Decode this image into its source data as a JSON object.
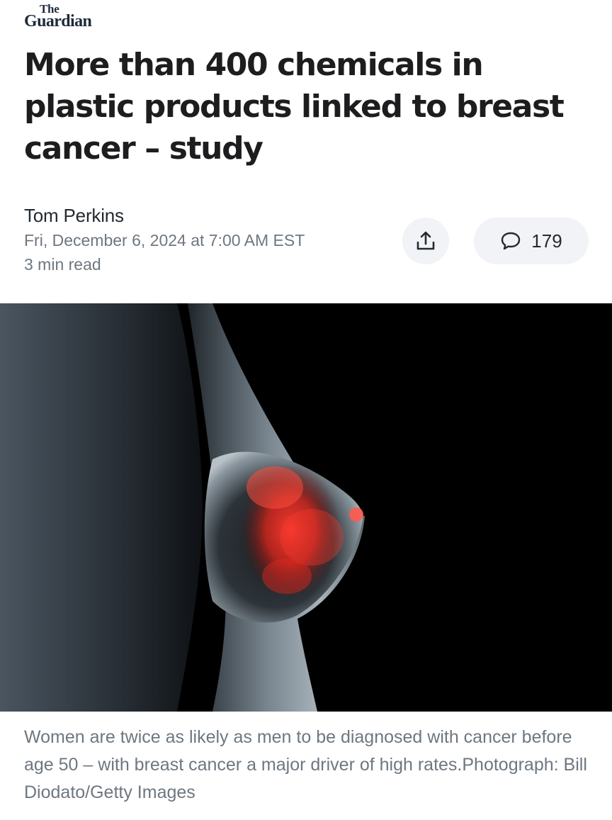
{
  "publisher": {
    "logo_line1": "The",
    "logo_line2": "Guardian"
  },
  "article": {
    "headline": "More than 400 chemicals in plastic products linked to breast cancer – study",
    "author": "Tom Perkins",
    "date": "Fri, December 6, 2024 at 7:00 AM EST",
    "read_time": "3 min read",
    "image_caption": "Women are twice as likely as men to be diagnosed with cancer before age 50 – with breast cancer a major driver of high rates.Photograph: Bill Diodato/Getty Images"
  },
  "actions": {
    "share_icon": "share-icon",
    "comment_icon": "comment-bubble-icon",
    "comments_count": "179"
  },
  "colors": {
    "headline": "#1d1d1f",
    "meta": "#6e7780",
    "button_bg": "#f1f3f6",
    "logo": "#1f2a3a"
  }
}
